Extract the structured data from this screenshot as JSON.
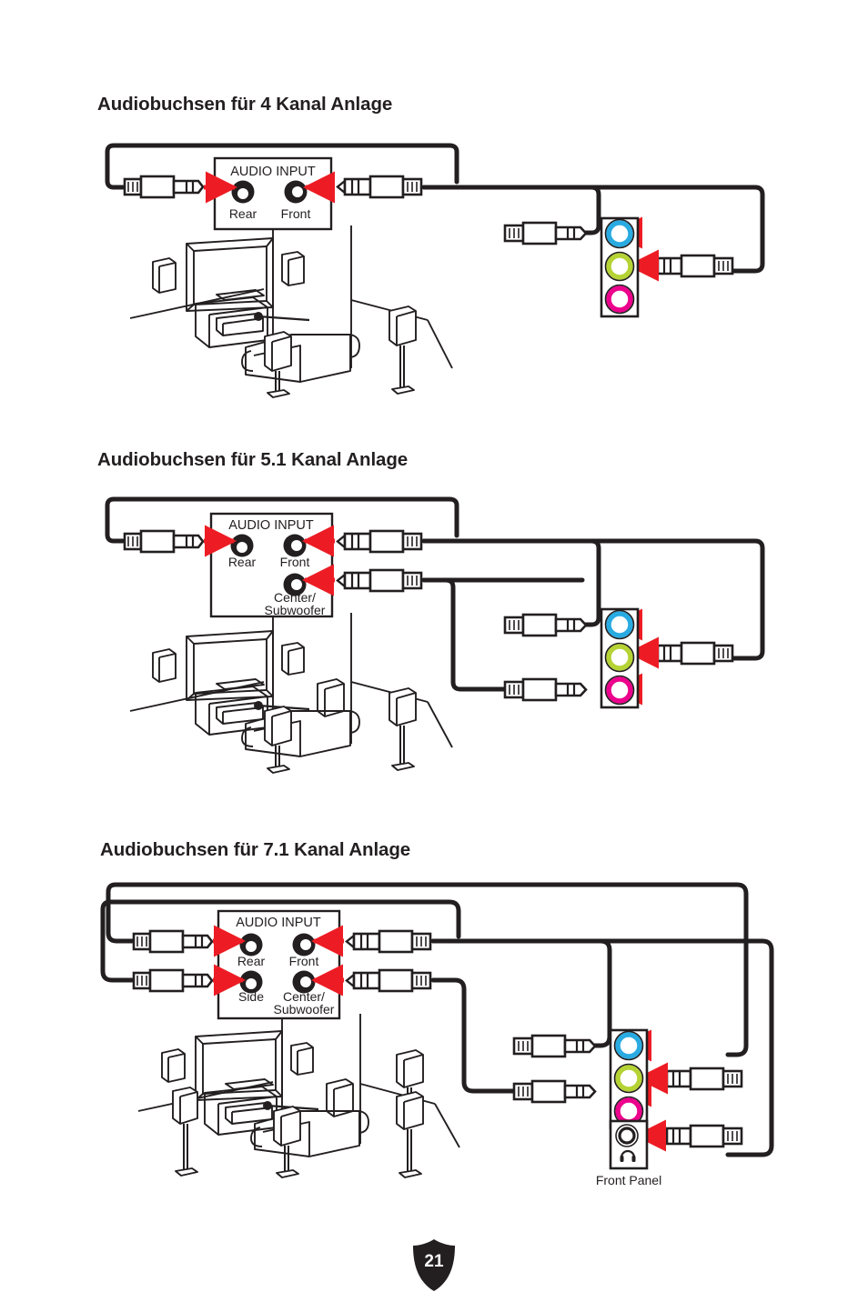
{
  "page": {
    "number": "21",
    "badge_shape": "shield",
    "badge_color": "#231f20",
    "background": "#ffffff"
  },
  "colors": {
    "ink": "#231f20",
    "arrow_red": "#ED1C24",
    "port_line_in_blue": "#29ABE2",
    "port_line_out_green": "#B5D334",
    "port_mic_pink": "#EC008C",
    "cable_black": "#231f20",
    "panel_white": "#ffffff"
  },
  "sections": [
    {
      "id": "four-channel",
      "title": "Audiobuchsen für 4 Kanal Anlage",
      "audio_input_box": {
        "label": "AUDIO INPUT",
        "jacks": [
          {
            "name": "Rear",
            "label": "Rear"
          },
          {
            "name": "Front",
            "label": "Front"
          }
        ]
      },
      "rear_panel_ports": [
        {
          "name": "line-in",
          "color": "#29ABE2",
          "connected": false
        },
        {
          "name": "line-out",
          "color": "#B5D334",
          "connected": true
        },
        {
          "name": "mic-in",
          "color": "#EC008C",
          "connected": false
        }
      ],
      "front_panel": null,
      "room": {
        "speakers": 2,
        "tv": true,
        "sofa": true,
        "av_receiver": true
      }
    },
    {
      "id": "five-one-channel",
      "title": "Audiobuchsen für 5.1 Kanal Anlage",
      "audio_input_box": {
        "label": "AUDIO INPUT",
        "jacks": [
          {
            "name": "Rear",
            "label": "Rear"
          },
          {
            "name": "Front",
            "label": "Front"
          },
          {
            "name": "CenterSubwoofer",
            "label": "Center/",
            "label2": "Subwoofer"
          }
        ]
      },
      "rear_panel_ports": [
        {
          "name": "line-in",
          "color": "#29ABE2",
          "connected": true
        },
        {
          "name": "line-out",
          "color": "#B5D334",
          "connected": true
        },
        {
          "name": "mic-in",
          "color": "#EC008C",
          "connected": true
        }
      ],
      "front_panel": null,
      "room": {
        "speakers": 4,
        "tv": true,
        "sofa": true,
        "av_receiver": true
      }
    },
    {
      "id": "seven-one-channel",
      "title": "Audiobuchsen für 7.1 Kanal Anlage",
      "audio_input_box": {
        "label": "AUDIO INPUT",
        "jacks": [
          {
            "name": "Rear",
            "label": "Rear"
          },
          {
            "name": "Front",
            "label": "Front"
          },
          {
            "name": "Side",
            "label": "Side"
          },
          {
            "name": "CenterSubwoofer",
            "label": "Center/",
            "label2": "Subwoofer"
          }
        ]
      },
      "rear_panel_ports": [
        {
          "name": "line-in",
          "color": "#29ABE2",
          "connected": true
        },
        {
          "name": "line-out",
          "color": "#B5D334",
          "connected": true
        },
        {
          "name": "mic-in",
          "color": "#EC008C",
          "connected": true
        }
      ],
      "front_panel": {
        "label": "Front Panel",
        "icon": "headphone-icon",
        "connected": true
      },
      "room": {
        "speakers": 6,
        "tv": true,
        "sofa": true,
        "av_receiver": true
      }
    }
  ]
}
